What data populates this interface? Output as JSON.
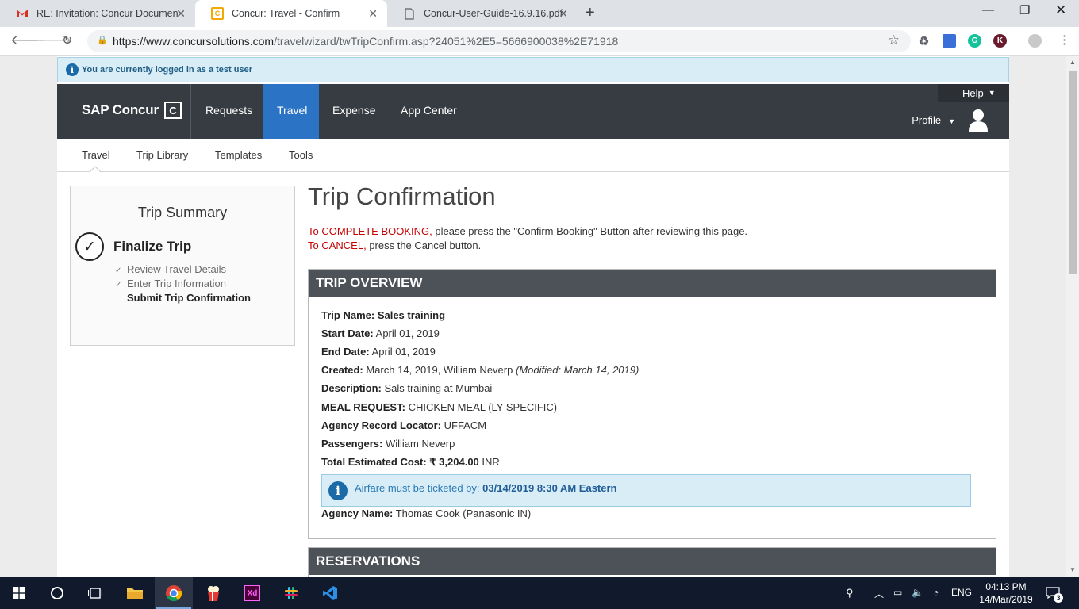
{
  "browser": {
    "tabs": [
      {
        "title": "RE: Invitation: Concur Documenta",
        "icon": "gmail-icon"
      },
      {
        "title": "Concur: Travel - Confirm",
        "icon": "concur-icon",
        "active": true
      },
      {
        "title": "Concur-User-Guide-16.9.16.pdf",
        "icon": "document-icon"
      }
    ],
    "url_host": "https://www.concursolutions.com",
    "url_path": "/travelwizard/twTripConfirm.asp?24051%2E5=5666900038%2E71918"
  },
  "banner": {
    "text": "You are currently logged in as a test user"
  },
  "nav": {
    "brand": "SAP Concur",
    "items": [
      "Requests",
      "Travel",
      "Expense",
      "App Center"
    ],
    "active": "Travel",
    "help": "Help",
    "profile": "Profile"
  },
  "subnav": {
    "items": [
      "Travel",
      "Trip Library",
      "Templates",
      "Tools"
    ]
  },
  "summary": {
    "title": "Trip Summary",
    "step_title": "Finalize Trip",
    "steps": [
      {
        "label": "Review Travel Details",
        "done": true
      },
      {
        "label": "Enter Trip Information",
        "done": true
      },
      {
        "label": "Submit Trip Confirmation",
        "done": false
      }
    ]
  },
  "page": {
    "title": "Trip Confirmation",
    "complete_red": "To COMPLETE BOOKING,",
    "complete_rest": " please press the \"Confirm Booking\" Button after reviewing this page.",
    "cancel_red": "To CANCEL,",
    "cancel_rest": " press the Cancel button."
  },
  "overview": {
    "heading": "TRIP OVERVIEW",
    "trip_name_label": "Trip Name:",
    "trip_name": "Sales training",
    "start_label": "Start Date:",
    "start": "April 01, 2019",
    "end_label": "End Date:",
    "end": "April 01, 2019",
    "created_label": "Created:",
    "created": "March 14, 2019, William Neverp",
    "modified": "(Modified: March 14, 2019)",
    "description_label": "Description:",
    "description": "Sals training at Mumbai",
    "meal_label": "MEAL REQUEST:",
    "meal": "CHICKEN MEAL (LY SPECIFIC)",
    "locator_label": "Agency Record Locator:",
    "locator": "UFFACM",
    "passengers_label": "Passengers:",
    "passengers": "William Neverp",
    "cost_label": "Total Estimated Cost:",
    "cost_amount": "₹ 3,204.00",
    "cost_currency": "INR",
    "alert_prefix": "Airfare must be ticketed by:",
    "alert_deadline": "03/14/2019 8:30 AM Eastern",
    "agency_label": "Agency Name:",
    "agency": "Thomas Cook (Panasonic IN)"
  },
  "reservations": {
    "heading": "RESERVATIONS"
  },
  "taskbar": {
    "language": "ENG",
    "time": "04:13 PM",
    "date": "14/Mar/2019",
    "notifications": "3"
  },
  "colors": {
    "nav_bg": "#373c42",
    "nav_active": "#2a73c5",
    "cta_red": "#c80000",
    "panel_head": "#4c5258",
    "info_bg": "#d9edf7"
  }
}
